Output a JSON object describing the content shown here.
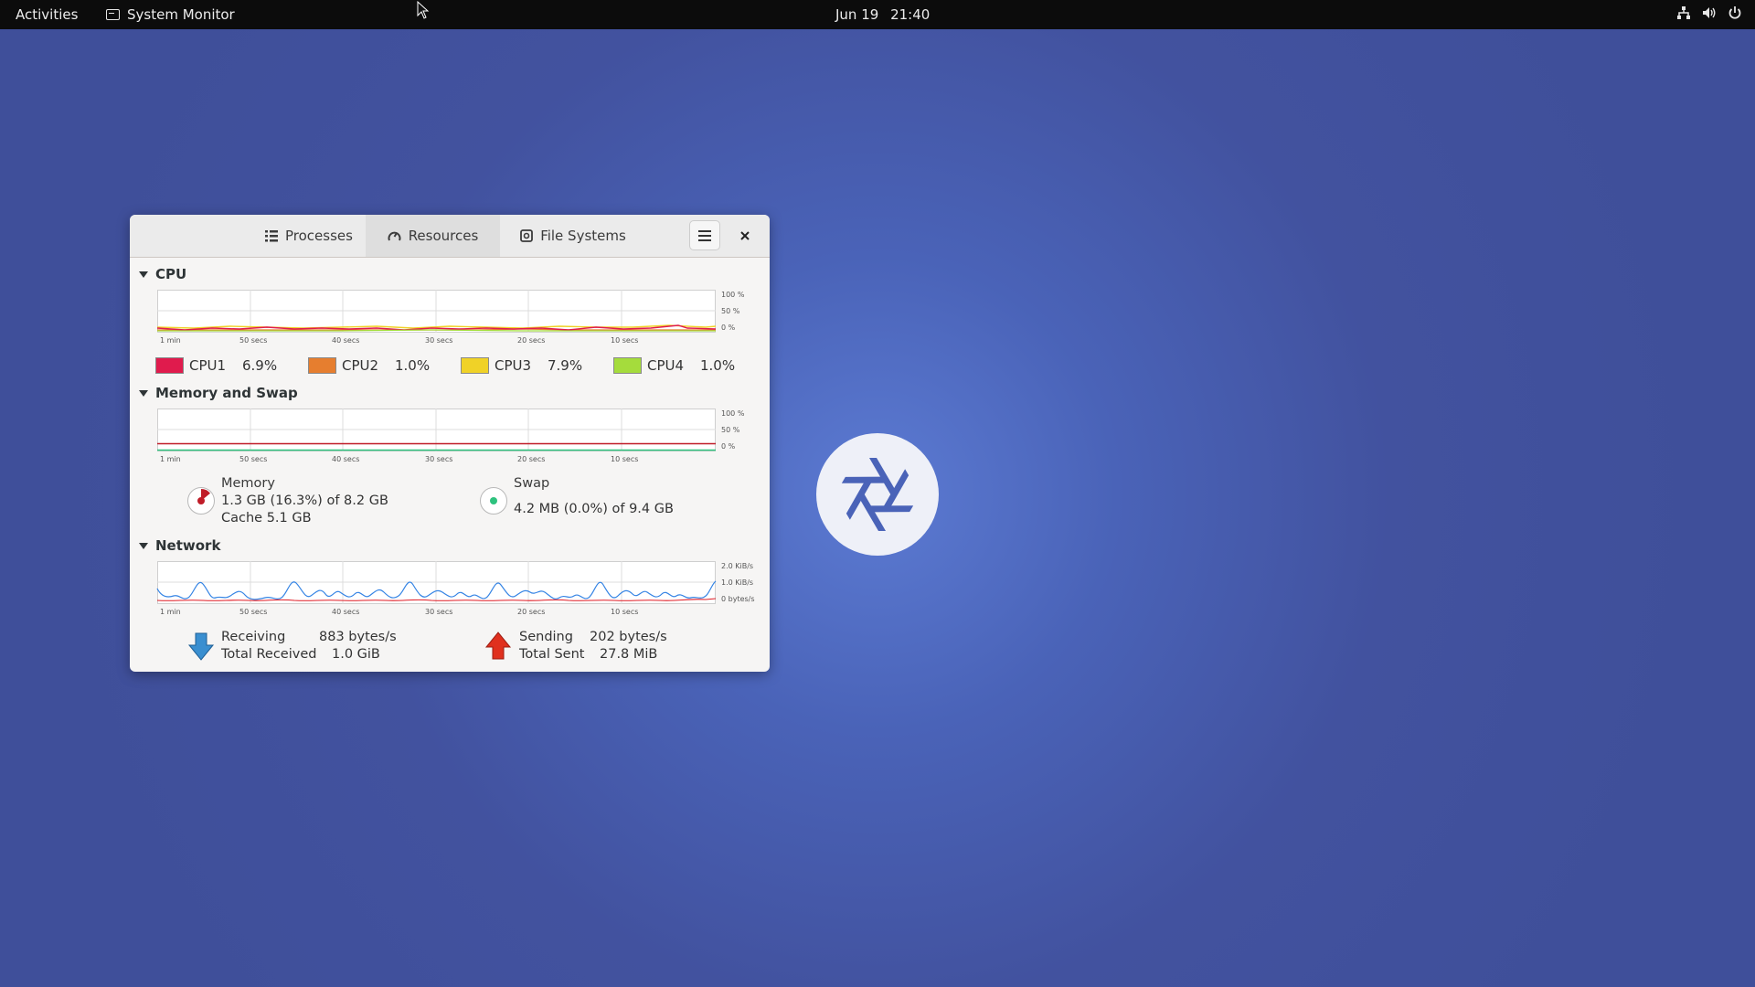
{
  "topbar": {
    "activities": "Activities",
    "app_name": "System Monitor",
    "date": "Jun 19",
    "time": "21:40"
  },
  "tabs": [
    {
      "label": "Processes",
      "icon": "list-icon"
    },
    {
      "label": "Resources",
      "icon": "gauge-icon",
      "active": true
    },
    {
      "label": "File Systems",
      "icon": "disk-icon"
    }
  ],
  "cpu": {
    "title": "CPU",
    "yticks": [
      "100 %",
      "50 %",
      "0 %"
    ],
    "xticks": [
      "1 min",
      "50 secs",
      "40 secs",
      "30 secs",
      "20 secs",
      "10 secs"
    ],
    "cores": [
      {
        "name": "CPU1",
        "value": "6.9%",
        "color": "#e01b4d"
      },
      {
        "name": "CPU2",
        "value": "1.0%",
        "color": "#e67e2f"
      },
      {
        "name": "CPU3",
        "value": "7.9%",
        "color": "#f0d227"
      },
      {
        "name": "CPU4",
        "value": "1.0%",
        "color": "#a5dc3c"
      }
    ]
  },
  "memory": {
    "title": "Memory and Swap",
    "yticks": [
      "100 %",
      "50 %",
      "0 %"
    ],
    "xticks": [
      "1 min",
      "50 secs",
      "40 secs",
      "30 secs",
      "20 secs",
      "10 secs"
    ],
    "memory_label": "Memory",
    "memory_value": "1.3 GB (16.3%) of 8.2 GB",
    "cache_value": "Cache 5.1 GB",
    "memory_color": "#c01c28",
    "swap_label": "Swap",
    "swap_value": "4.2 MB (0.0%) of 9.4 GB",
    "swap_color": "#2ec27e"
  },
  "network": {
    "title": "Network",
    "yticks": [
      "2.0 KiB/s",
      "1.0 KiB/s",
      "0 bytes/s"
    ],
    "xticks": [
      "1 min",
      "50 secs",
      "40 secs",
      "30 secs",
      "20 secs",
      "10 secs"
    ],
    "receiving_label": "Receiving",
    "receiving_value": "883 bytes/s",
    "total_received_label": "Total Received",
    "total_received_value": "1.0 GiB",
    "sending_label": "Sending",
    "sending_value": "202 bytes/s",
    "total_sent_label": "Total Sent",
    "total_sent_value": "27.8 MiB",
    "receive_color": "#3584e4",
    "send_color": "#e01b24"
  }
}
